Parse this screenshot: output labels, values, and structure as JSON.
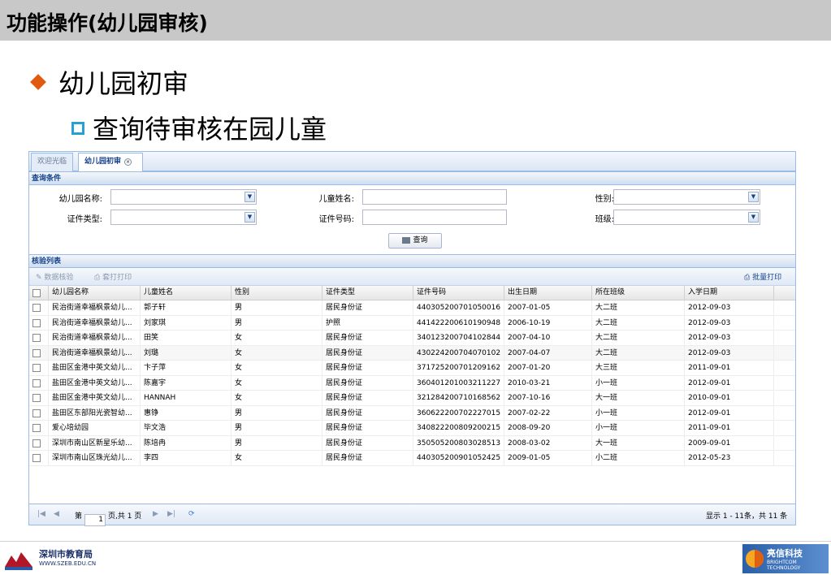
{
  "slide": {
    "title": "功能操作(幼儿园审核)",
    "bullet1": "幼儿园初审",
    "bullet2": "查询待审核在园儿童"
  },
  "app": {
    "tabs": [
      {
        "label": "欢迎光临"
      },
      {
        "label": "幼儿园初审"
      }
    ],
    "query_section": "查询条件",
    "form": {
      "kindergarten_label": "幼儿园名称:",
      "child_name_label": "儿童姓名:",
      "gender_label": "性别:",
      "id_type_label": "证件类型:",
      "id_number_label": "证件号码:",
      "class_label": "班级:",
      "query_button": "查询"
    },
    "list_section": "核验列表",
    "toolbar": {
      "verify": "数据核验",
      "print": "套打打印",
      "batch_print": "批量打印"
    },
    "columns": [
      "幼儿园名称",
      "儿童姓名",
      "性别",
      "证件类型",
      "证件号码",
      "出生日期",
      "所在班级",
      "入学日期"
    ],
    "rows": [
      [
        "民治街道幸福枫景幼儿...",
        "郭子轩",
        "男",
        "居民身份证",
        "440305200701050016",
        "2007-01-05",
        "大二班",
        "2012-09-03"
      ],
      [
        "民治街道幸福枫景幼儿...",
        "刘家琪",
        "男",
        "护照",
        "441422200610190948",
        "2006-10-19",
        "大二班",
        "2012-09-03"
      ],
      [
        "民治街道幸福枫景幼儿...",
        "田笑",
        "女",
        "居民身份证",
        "340123200704102844",
        "2007-04-10",
        "大二班",
        "2012-09-03"
      ],
      [
        "民治街道幸福枫景幼儿...",
        "刘璐",
        "女",
        "居民身份证",
        "430224200704070102",
        "2007-04-07",
        "大二班",
        "2012-09-03"
      ],
      [
        "盐田区金港中英文幼儿...",
        "卞子萍",
        "女",
        "居民身份证",
        "371725200701209162",
        "2007-01-20",
        "大三班",
        "2011-09-01"
      ],
      [
        "盐田区金港中英文幼儿...",
        "陈嘉宇",
        "女",
        "居民身份证",
        "360401201003211227",
        "2010-03-21",
        "小一班",
        "2012-09-01"
      ],
      [
        "盐田区金港中英文幼儿...",
        "HANNAH",
        "女",
        "居民身份证",
        "321284200710168562",
        "2007-10-16",
        "大一班",
        "2010-09-01"
      ],
      [
        "盐田区东部阳光瓷智幼...",
        "惠铮",
        "男",
        "居民身份证",
        "360622200702227015",
        "2007-02-22",
        "小一班",
        "2012-09-01"
      ],
      [
        "爱心培幼园",
        "毕文浩",
        "男",
        "居民身份证",
        "340822200809200215",
        "2008-09-20",
        "小一班",
        "2011-09-01"
      ],
      [
        "深圳市南山区新星乐幼...",
        "陈培冉",
        "男",
        "居民身份证",
        "350505200803028513",
        "2008-03-02",
        "大一班",
        "2009-09-01"
      ],
      [
        "深圳市南山区珠光幼儿...",
        "李四",
        "女",
        "居民身份证",
        "440305200901052425",
        "2009-01-05",
        "小二班",
        "2012-05-23"
      ]
    ],
    "pager": {
      "page_prefix": "第",
      "page_value": "1",
      "page_suffix": "页,共 1 页",
      "summary": "显示 1 - 11条，共 11 条"
    }
  },
  "footer": {
    "left_title": "深圳市教育局",
    "left_url": "WWW.SZEB.EDU.CN",
    "right_title": "亮信科技",
    "right_sub": "BRIGHTCOM TECHNOLOGY"
  }
}
